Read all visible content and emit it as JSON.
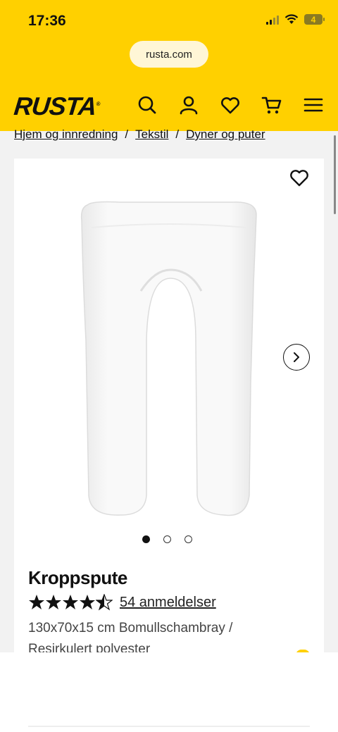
{
  "status_bar": {
    "time": "17:36",
    "battery": "4"
  },
  "browser": {
    "url": "rusta.com"
  },
  "header": {
    "logo": "RUSTA",
    "icons": [
      "search-icon",
      "account-icon",
      "wishlist-icon",
      "cart-icon",
      "menu-icon"
    ]
  },
  "breadcrumb": [
    "Hjem og innredning",
    "Tekstil",
    "Dyner og puter"
  ],
  "product": {
    "name": "Kroppspute",
    "rating": 4.5,
    "reviews_label": "54 anmeldelser",
    "description": "130x70x15 cm Bomullschambray / Resirkulert polyester",
    "image_count": 3,
    "active_image": 0
  },
  "colors": {
    "brand_yellow": "#ffd000"
  }
}
